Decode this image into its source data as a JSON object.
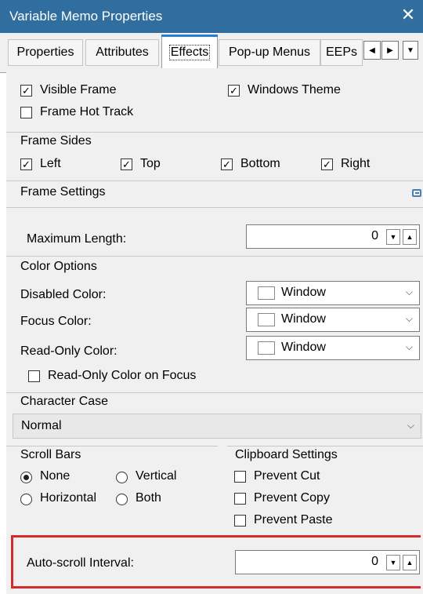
{
  "window": {
    "title": "Variable Memo Properties",
    "close": "✕"
  },
  "tabs": {
    "items": [
      "Properties",
      "Attributes",
      "Effects",
      "Pop-up Menus",
      "EEPs"
    ],
    "scroll_left": "◀",
    "scroll_right": "▶",
    "scroll_down": "▼"
  },
  "frame": {
    "visible_frame": "Visible Frame",
    "visible_frame_checked": true,
    "windows_theme": "Windows Theme",
    "windows_theme_checked": true,
    "frame_hot_track": "Frame Hot Track",
    "frame_hot_track_checked": false
  },
  "frame_sides": {
    "title": "Frame Sides",
    "left": "Left",
    "top": "Top",
    "bottom": "Bottom",
    "right": "Right",
    "checked": [
      true,
      true,
      true,
      true
    ]
  },
  "frame_settings": {
    "title": "Frame Settings"
  },
  "max_length": {
    "label": "Maximum Length:",
    "value": "0"
  },
  "color_options": {
    "title": "Color Options",
    "disabled_label": "Disabled Color:",
    "disabled_value": "Window",
    "focus_label": "Focus Color:",
    "focus_value": "Window",
    "readonly_label": "Read-Only Color:",
    "readonly_value": "Window",
    "readonly_focus": "Read-Only Color on Focus",
    "readonly_focus_checked": false
  },
  "character_case": {
    "title": "Character Case",
    "value": "Normal"
  },
  "scroll_bars": {
    "title": "Scroll Bars",
    "none": "None",
    "vertical": "Vertical",
    "horizontal": "Horizontal",
    "both": "Both",
    "selected": "None"
  },
  "clipboard": {
    "title": "Clipboard Settings",
    "prevent_cut": "Prevent Cut",
    "prevent_copy": "Prevent Copy",
    "prevent_paste": "Prevent Paste"
  },
  "auto_scroll": {
    "label": "Auto-scroll Interval:",
    "value": "0"
  },
  "glyphs": {
    "check": "✓",
    "spin_down": "▼",
    "spin_up": "▲",
    "chevron": "⌵"
  },
  "colors": {
    "titlebar": "#2f6e9e",
    "highlight_box": "#d12b2b",
    "active_tab_accent": "#2b7cd3"
  }
}
